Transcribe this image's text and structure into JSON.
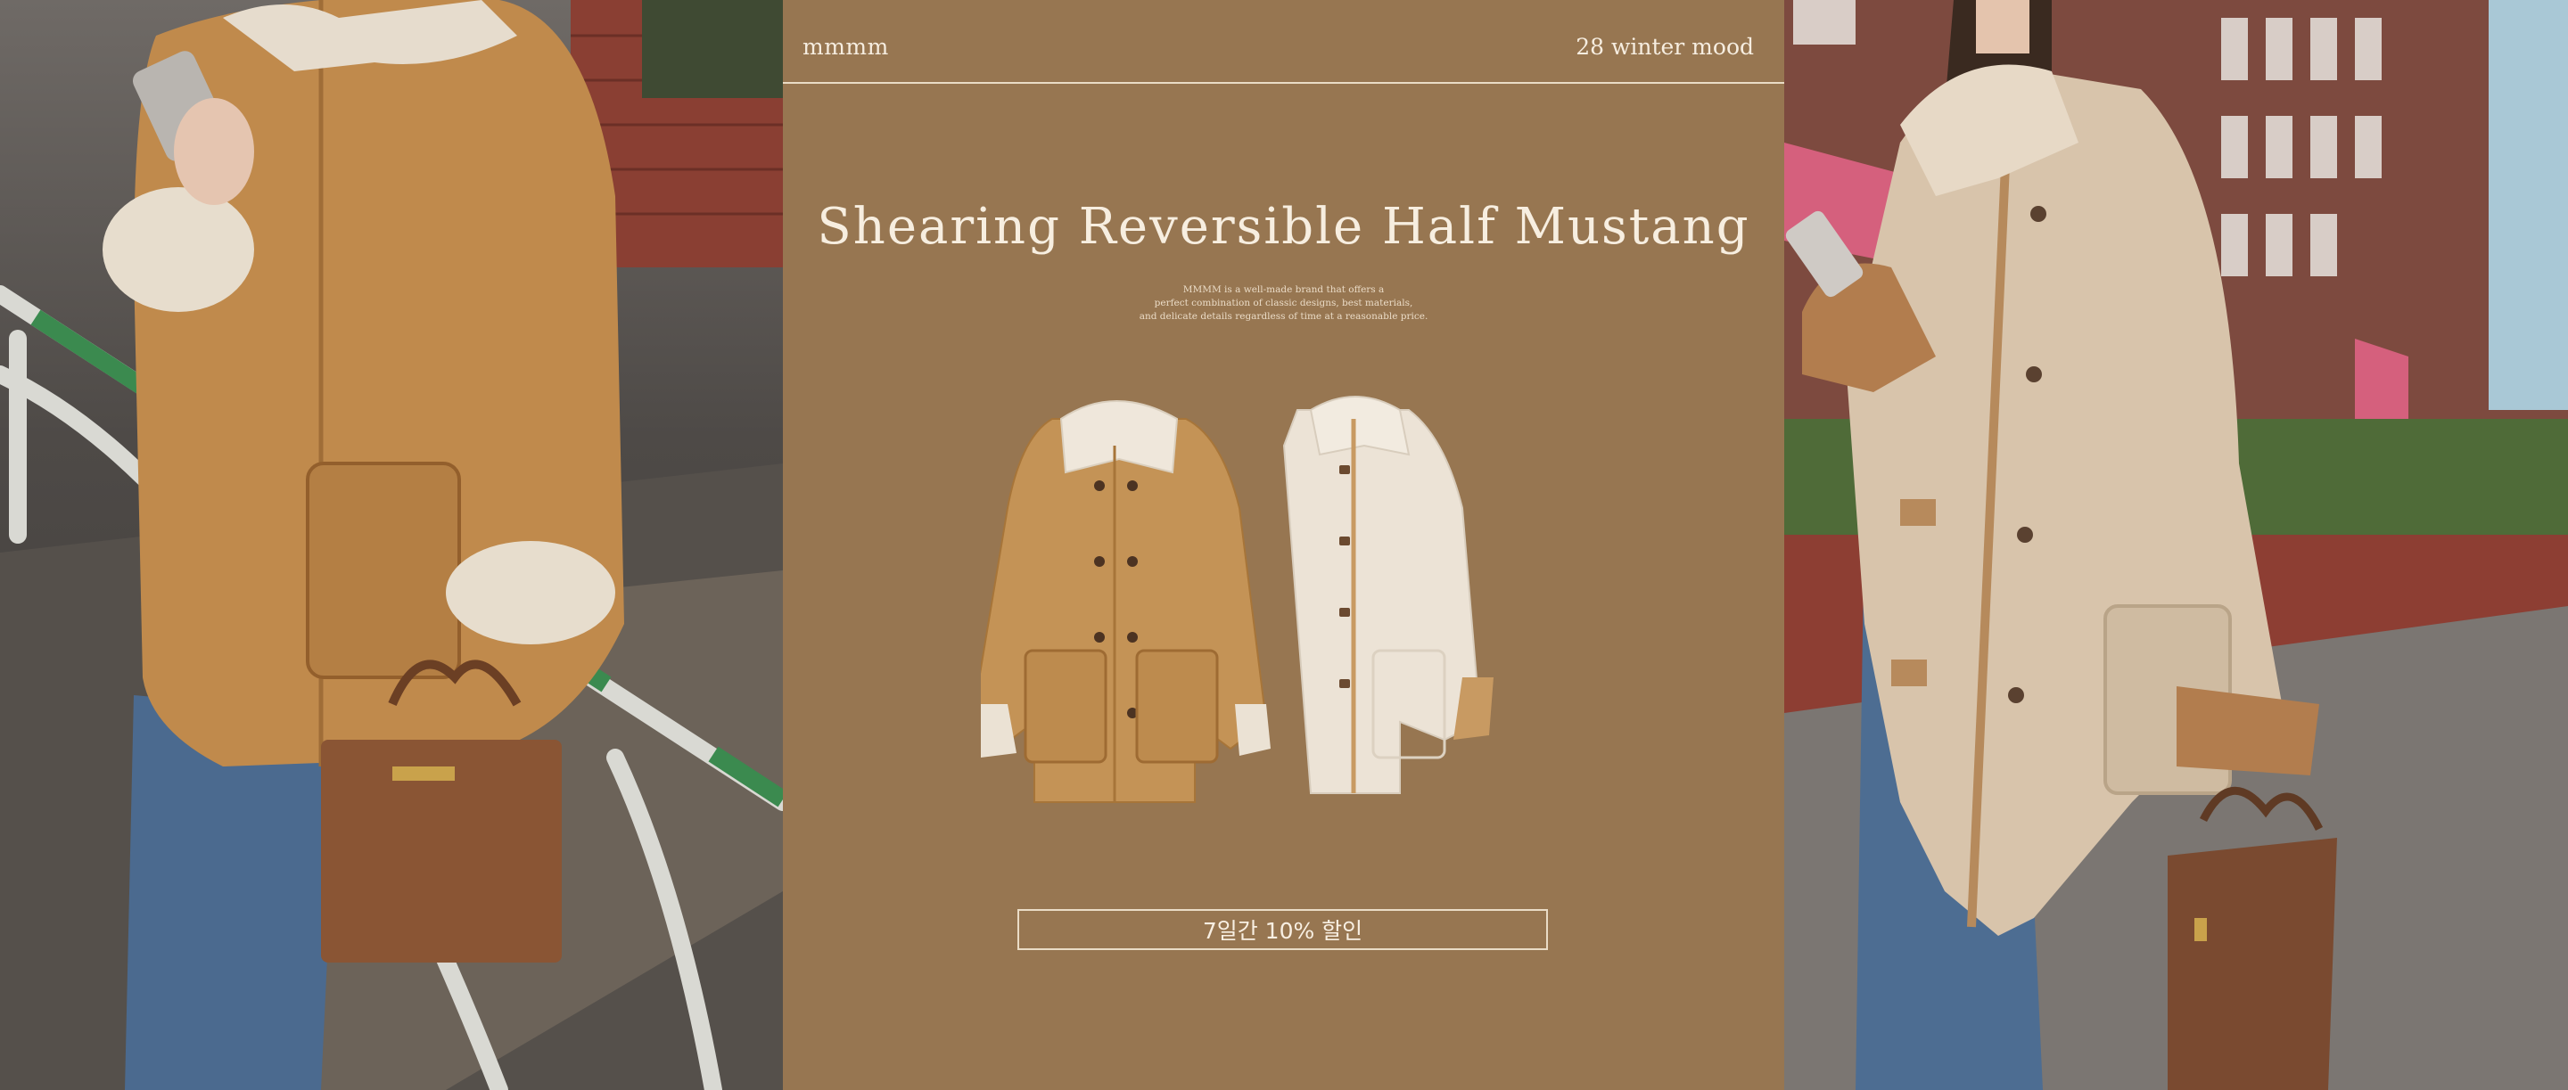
{
  "brand": "mmmm",
  "season": "28 winter mood",
  "title": "Shearing Reversible Half Mustang",
  "description": [
    "MMMM is a well-made brand that offers a",
    "perfect combination of classic designs, best materials,",
    "and delicate details regardless of time at a reasonable price."
  ],
  "promo": "7일간 10% 할인",
  "colors": {
    "background": "#977651",
    "text": "#f4eadb",
    "coat_suede": "#c39558",
    "coat_shearling": "#ece4d8"
  }
}
